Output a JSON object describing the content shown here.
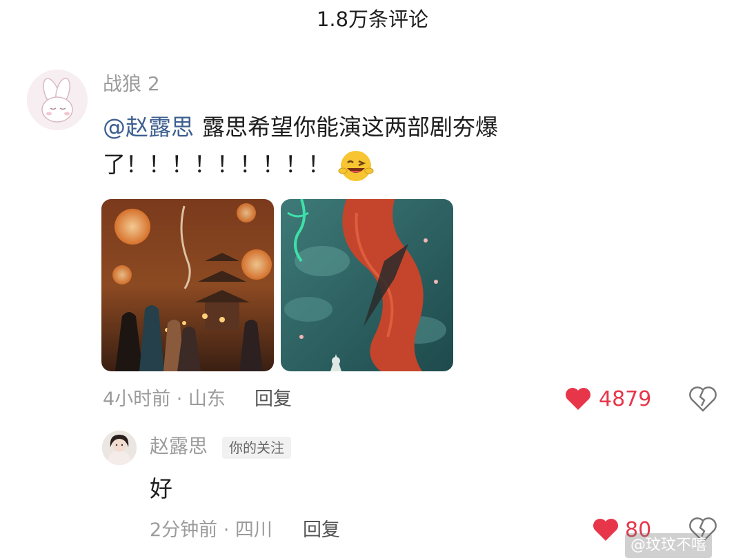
{
  "header": {
    "title": "1.8万条评论"
  },
  "comment": {
    "avatar_icon": "bunny-avatar-icon",
    "username": "战狼 2",
    "mention": "@赵露思",
    "text": "露思希望你能演这两部剧夯爆了！！！！！！！！！",
    "emoji": "laughing-wink-emoji",
    "time_location": "4小时前 · 山东",
    "reply_label": "回复",
    "like_count": "4879",
    "colors": {
      "like": "#e7364a",
      "mention": "#3d5f8f"
    }
  },
  "reply": {
    "username": "赵露思",
    "badge": "你的关注",
    "text": "好",
    "time_location": "2分钟前 · 四川",
    "reply_label": "回复",
    "like_count": "80"
  },
  "watermark": {
    "text": "@玟玟不嘻"
  }
}
